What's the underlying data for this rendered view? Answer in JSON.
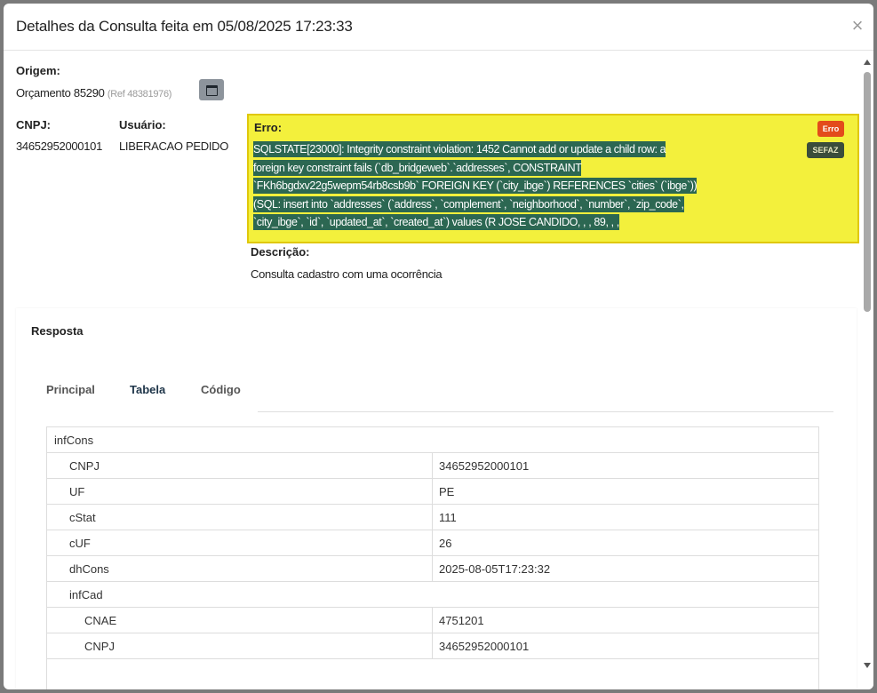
{
  "modal": {
    "title": "Detalhes da Consulta feita em 05/08/2025 17:23:33",
    "close_glyph": "×"
  },
  "origem": {
    "label": "Origem:",
    "value": "Orçamento 85290",
    "ref": "(Ref 48381976)"
  },
  "cnpj": {
    "label": "CNPJ:",
    "value": "34652952000101"
  },
  "usuario": {
    "label": "Usuário:",
    "value": "LIBERACAO PEDIDO"
  },
  "erro": {
    "label": "Erro:",
    "lines": [
      "SQLSTATE[23000]: Integrity constraint violation: 1452 Cannot add or update a child row: a",
      "foreign key constraint fails (`db_bridgeweb`.`addresses`, CONSTRAINT",
      "`FKh6bgdxv22g5wepm54rb8csb9b` FOREIGN KEY (`city_ibge`) REFERENCES `cities` (`ibge`))",
      "(SQL: insert into `addresses` (`address`, `complement`, `neighborhood`, `number`, `zip_code`,",
      "`city_ibge`, `id`, `updated_at`, `created_at`) values (R JOSE CANDIDO, , , 89, , ,"
    ],
    "badge_erro": "Erro",
    "badge_sefaz": "SEFAZ"
  },
  "descricao": {
    "label": "Descrição:",
    "value": "Consulta cadastro com uma ocorrência"
  },
  "resposta": {
    "title": "Resposta",
    "tabs": [
      {
        "label": "Principal",
        "active": false
      },
      {
        "label": "Tabela",
        "active": true
      },
      {
        "label": "Código",
        "active": false
      }
    ],
    "rows": [
      {
        "key": "infCons",
        "value": "",
        "level": 0
      },
      {
        "key": "CNPJ",
        "value": "34652952000101",
        "level": 1
      },
      {
        "key": "UF",
        "value": "PE",
        "level": 1
      },
      {
        "key": "cStat",
        "value": "111",
        "level": 1
      },
      {
        "key": "cUF",
        "value": "26",
        "level": 1
      },
      {
        "key": "dhCons",
        "value": "2025-08-05T17:23:32",
        "level": 1
      },
      {
        "key": "infCad",
        "value": "",
        "level": 1
      },
      {
        "key": "CNAE",
        "value": "4751201",
        "level": 2
      },
      {
        "key": "CNPJ",
        "value": "34652952000101",
        "level": 2
      }
    ]
  }
}
